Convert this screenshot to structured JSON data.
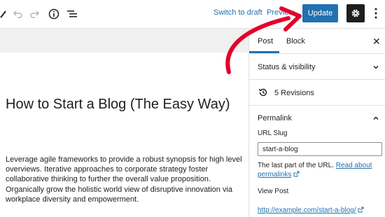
{
  "toolbar": {
    "switch_to_draft": "Switch to draft",
    "preview": "Preview",
    "update": "Update",
    "icons": [
      "edit-icon",
      "undo-icon",
      "redo-icon",
      "info-icon",
      "list-view-icon",
      "settings-icon",
      "more-options-icon"
    ]
  },
  "editor": {
    "title": "How to Start a Blog (The Easy Way)",
    "paragraph": "Leverage agile frameworks to provide a robust synopsis for high level overviews. Iterative approaches to corporate strategy foster collaborative thinking to further the overall value proposition. Organically grow the holistic world view of disruptive innovation via workplace diversity and empowerment."
  },
  "sidebar": {
    "tabs": [
      "Post",
      "Block"
    ],
    "active_tab": "Post",
    "status_visibility": "Status & visibility",
    "revisions": "5 Revisions",
    "permalink": {
      "heading": "Permalink",
      "url_slug_label": "URL Slug",
      "url_slug_value": "start-a-blog",
      "help_prefix": "The last part of the URL.",
      "help_link": "Read about permalinks",
      "view_post_label": "View Post",
      "view_post_link": "http://example.com/start-a-blog/"
    }
  },
  "colors": {
    "accent": "#2271b1",
    "annotation_arrow": "#e4002b",
    "dark": "#1e1e1e"
  }
}
